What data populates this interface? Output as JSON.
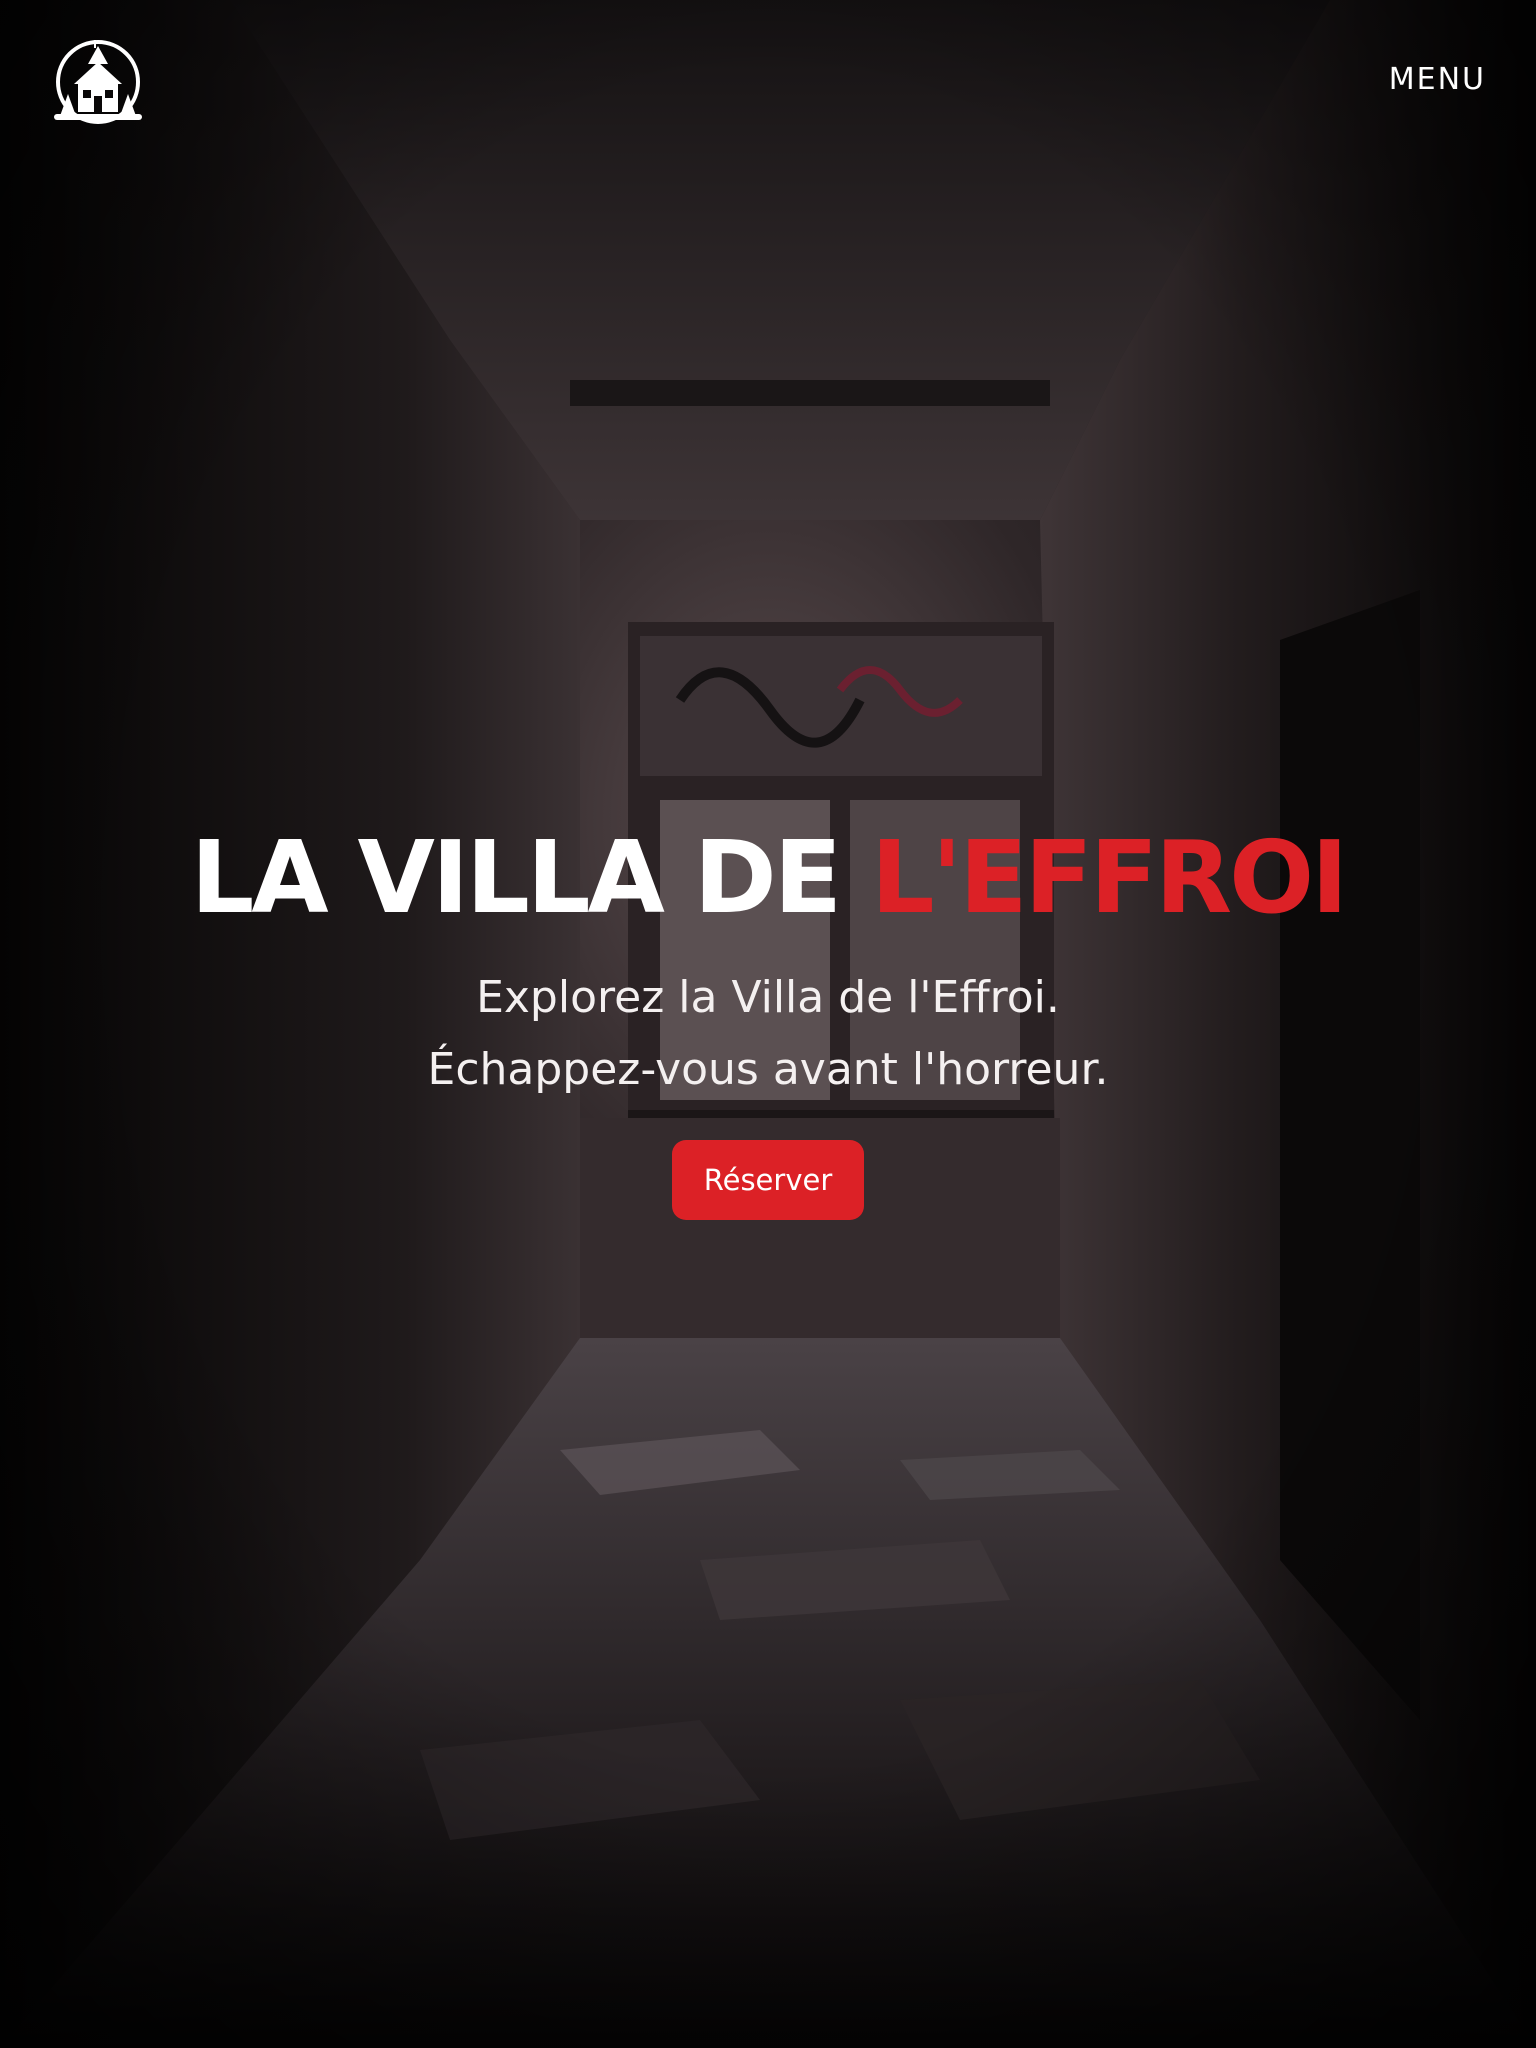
{
  "header": {
    "logo_icon": "haunted-house-logo-icon",
    "menu_label": "MENU"
  },
  "hero": {
    "title_white": "LA VILLA DE",
    "title_accent": "L'EFFROI",
    "subtitle_line1": "Explorez la Villa de l'Effroi.",
    "subtitle_line2": "Échappez-vous avant l'horreur.",
    "cta_label": "Réserver",
    "background": "abandoned-corridor-photo"
  },
  "colors": {
    "accent": "#dc2126",
    "text": "#ffffff",
    "background": "#0a0808"
  }
}
